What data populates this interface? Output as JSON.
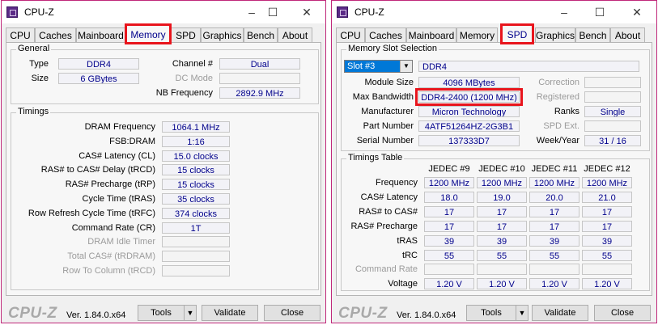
{
  "left": {
    "title": "CPU-Z",
    "tabs": [
      "CPU",
      "Caches",
      "Mainboard",
      "Memory",
      "SPD",
      "Graphics",
      "Bench",
      "About"
    ],
    "active_tab": "Memory",
    "general": {
      "title": "General",
      "type_label": "Type",
      "type_value": "DDR4",
      "size_label": "Size",
      "size_value": "6 GBytes",
      "channel_label": "Channel #",
      "channel_value": "Dual",
      "dcmode_label": "DC Mode",
      "dcmode_value": "",
      "nbfreq_label": "NB Frequency",
      "nbfreq_value": "2892.9 MHz"
    },
    "timings": {
      "title": "Timings",
      "rows": [
        {
          "label": "DRAM Frequency",
          "value": "1064.1 MHz",
          "disabled": false
        },
        {
          "label": "FSB:DRAM",
          "value": "1:16",
          "disabled": false
        },
        {
          "label": "CAS# Latency (CL)",
          "value": "15.0 clocks",
          "disabled": false
        },
        {
          "label": "RAS# to CAS# Delay (tRCD)",
          "value": "15 clocks",
          "disabled": false
        },
        {
          "label": "RAS# Precharge (tRP)",
          "value": "15 clocks",
          "disabled": false
        },
        {
          "label": "Cycle Time (tRAS)",
          "value": "35 clocks",
          "disabled": false
        },
        {
          "label": "Row Refresh Cycle Time (tRFC)",
          "value": "374 clocks",
          "disabled": false
        },
        {
          "label": "Command Rate (CR)",
          "value": "1T",
          "disabled": false
        },
        {
          "label": "DRAM Idle Timer",
          "value": "",
          "disabled": true
        },
        {
          "label": "Total CAS# (tRDRAM)",
          "value": "",
          "disabled": true
        },
        {
          "label": "Row To Column (tRCD)",
          "value": "",
          "disabled": true
        }
      ]
    },
    "footer": {
      "brand": "CPU-Z",
      "version": "Ver. 1.84.0.x64",
      "tools": "Tools",
      "validate": "Validate",
      "close": "Close"
    }
  },
  "right": {
    "title": "CPU-Z",
    "tabs": [
      "CPU",
      "Caches",
      "Mainboard",
      "Memory",
      "SPD",
      "Graphics",
      "Bench",
      "About"
    ],
    "active_tab": "SPD",
    "slot": {
      "title": "Memory Slot Selection",
      "selected_slot": "Slot #3",
      "type_value": "DDR4",
      "module_size_label": "Module Size",
      "module_size_value": "4096 MBytes",
      "max_bw_label": "Max Bandwidth",
      "max_bw_value": "DDR4-2400 (1200 MHz)",
      "manufacturer_label": "Manufacturer",
      "manufacturer_value": "Micron Technology",
      "part_label": "Part Number",
      "part_value": "4ATF51264HZ-2G3B1",
      "serial_label": "Serial Number",
      "serial_value": "137333D7",
      "correction_label": "Correction",
      "registered_label": "Registered",
      "ranks_label": "Ranks",
      "ranks_value": "Single",
      "spdext_label": "SPD Ext.",
      "spdext_value": "",
      "weekyear_label": "Week/Year",
      "weekyear_value": "31 / 16"
    },
    "timings_table": {
      "title": "Timings Table",
      "columns": [
        "JEDEC #9",
        "JEDEC #10",
        "JEDEC #11",
        "JEDEC #12"
      ],
      "rows": [
        {
          "label": "Frequency",
          "values": [
            "1200 MHz",
            "1200 MHz",
            "1200 MHz",
            "1200 MHz"
          ],
          "disabled": false
        },
        {
          "label": "CAS# Latency",
          "values": [
            "18.0",
            "19.0",
            "20.0",
            "21.0"
          ],
          "disabled": false
        },
        {
          "label": "RAS# to CAS#",
          "values": [
            "17",
            "17",
            "17",
            "17"
          ],
          "disabled": false
        },
        {
          "label": "RAS# Precharge",
          "values": [
            "17",
            "17",
            "17",
            "17"
          ],
          "disabled": false
        },
        {
          "label": "tRAS",
          "values": [
            "39",
            "39",
            "39",
            "39"
          ],
          "disabled": false
        },
        {
          "label": "tRC",
          "values": [
            "55",
            "55",
            "55",
            "55"
          ],
          "disabled": false
        },
        {
          "label": "Command Rate",
          "values": [
            "",
            "",
            "",
            ""
          ],
          "disabled": true
        },
        {
          "label": "Voltage",
          "values": [
            "1.20 V",
            "1.20 V",
            "1.20 V",
            "1.20 V"
          ],
          "disabled": false
        }
      ]
    },
    "footer": {
      "brand": "CPU-Z",
      "version": "Ver. 1.84.0.x64",
      "tools": "Tools",
      "validate": "Validate",
      "close": "Close"
    }
  },
  "colors": {
    "highlight": "#e8141c",
    "value_text": "#00008b",
    "brand_gray": "#a9a9a9",
    "slot_select": "#0078d7"
  }
}
